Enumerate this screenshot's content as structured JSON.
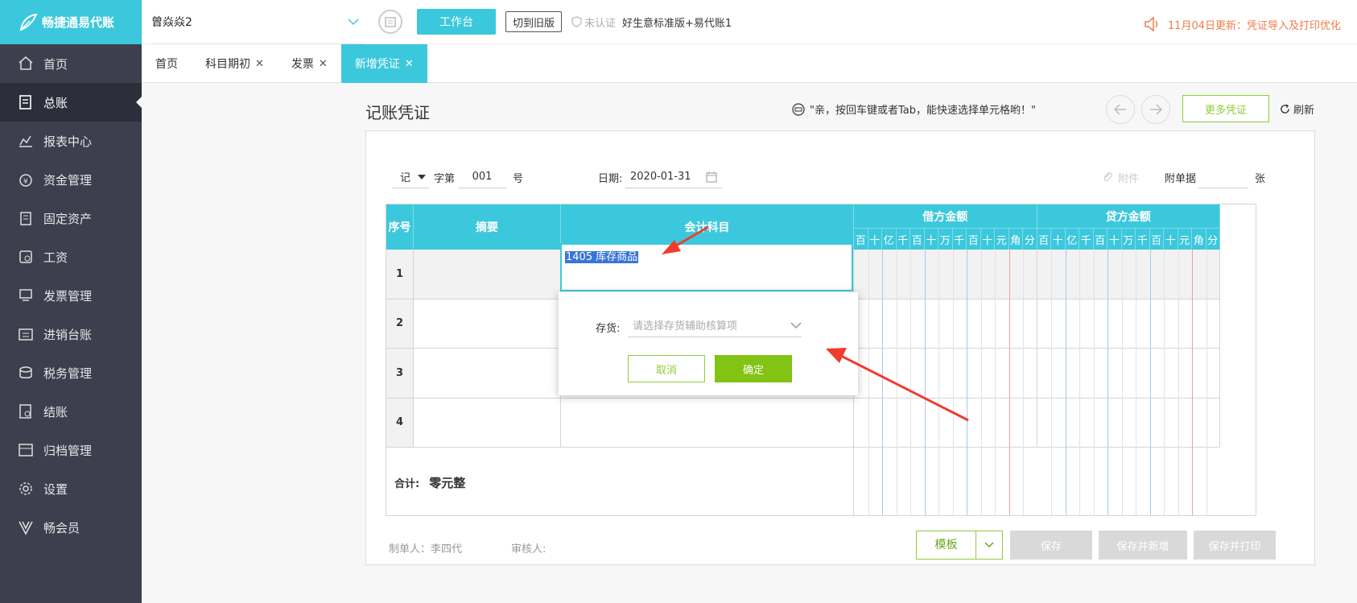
{
  "app": {
    "logo_text": "畅捷通易代账"
  },
  "sidebar": {
    "items": [
      {
        "label": "首页",
        "icon": "home-icon"
      },
      {
        "label": "总账",
        "icon": "ledger-icon",
        "active": true
      },
      {
        "label": "报表中心",
        "icon": "chart-icon"
      },
      {
        "label": "资金管理",
        "icon": "money-bag-icon"
      },
      {
        "label": "固定资产",
        "icon": "building-icon"
      },
      {
        "label": "工资",
        "icon": "salary-icon"
      },
      {
        "label": "发票管理",
        "icon": "invoice-icon"
      },
      {
        "label": "进销台账",
        "icon": "inventory-icon"
      },
      {
        "label": "税务管理",
        "icon": "tax-icon"
      },
      {
        "label": "结账",
        "icon": "close-account-icon"
      },
      {
        "label": "归档管理",
        "icon": "archive-icon"
      },
      {
        "label": "设置",
        "icon": "gear-icon"
      },
      {
        "label": "畅会员",
        "icon": "vip-icon"
      }
    ]
  },
  "topbar": {
    "company": "曾焱焱2",
    "workbench": "工作台",
    "switch_old": "切到旧版",
    "unverified": "未认证",
    "product": "好生意标准版+易代账1",
    "notice": "11月04日更新：凭证导入及打印优化"
  },
  "tabs": [
    {
      "label": "首页",
      "closable": false
    },
    {
      "label": "科目期初",
      "closable": true
    },
    {
      "label": "发票",
      "closable": true
    },
    {
      "label": "新增凭证",
      "closable": true,
      "active": true
    }
  ],
  "page": {
    "title": "记账凭证",
    "hint": "\"亲，按回车键或者Tab，能快速选择单元格哟！\"",
    "more": "更多凭证",
    "refresh": "刷新"
  },
  "voucher": {
    "word": "记",
    "word_label": "字第",
    "number": "001",
    "number_suffix": "号",
    "date_label": "日期:",
    "date": "2020-01-31",
    "attach": "附件",
    "doc_label": "附单据",
    "doc_count": "",
    "doc_unit": "张"
  },
  "table": {
    "headers": {
      "seq": "序号",
      "summary": "摘要",
      "subject": "会计科目",
      "debit": "借方金额",
      "credit": "贷方金额"
    },
    "digits": [
      "百",
      "十",
      "亿",
      "千",
      "百",
      "十",
      "万",
      "千",
      "百",
      "十",
      "元",
      "角",
      "分"
    ],
    "rows": [
      "1",
      "2",
      "3",
      "4"
    ],
    "subject_value": "1405  库存商品",
    "total_label": "合计:",
    "total_value": "零元整"
  },
  "popup": {
    "label": "存货:",
    "placeholder": "请选择存货辅助核算项",
    "cancel": "取消",
    "ok": "确定"
  },
  "footer": {
    "maker": "制单人：李四代",
    "auditor": "审核人:",
    "template": "模板",
    "save": "保存",
    "save_new": "保存并新增",
    "save_print": "保存并打印"
  },
  "colors": {
    "accent": "#3cc8dc",
    "green": "#8fcd3b",
    "sidebar": "#3d3f4e",
    "annotation": "#f03c2a"
  }
}
